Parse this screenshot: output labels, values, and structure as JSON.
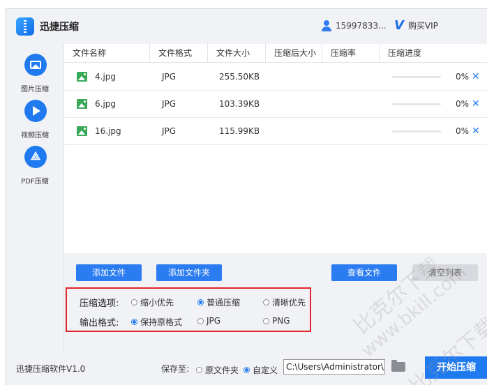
{
  "app": {
    "title": "迅捷压缩"
  },
  "user": {
    "phone": "15997833...",
    "vip_label": "购买VIP"
  },
  "sidebar": {
    "items": [
      {
        "label": "图片压缩"
      },
      {
        "label": "视频压缩"
      },
      {
        "label": "PDF压缩"
      }
    ]
  },
  "table": {
    "headers": [
      "文件名称",
      "文件格式",
      "文件大小",
      "压缩后大小",
      "压缩率",
      "压缩进度"
    ],
    "rows": [
      {
        "name": "4.jpg",
        "format": "JPG",
        "size": "255.50KB",
        "compressed_size": "",
        "ratio": "",
        "progress_pct": "0%",
        "progress_value": 0
      },
      {
        "name": "6.jpg",
        "format": "JPG",
        "size": "103.39KB",
        "compressed_size": "",
        "ratio": "",
        "progress_pct": "0%",
        "progress_value": 0
      },
      {
        "name": "16.jpg",
        "format": "JPG",
        "size": "115.99KB",
        "compressed_size": "",
        "ratio": "",
        "progress_pct": "0%",
        "progress_value": 0
      }
    ]
  },
  "buttons": {
    "add_file": "添加文件",
    "add_folder": "添加文件夹",
    "view_files": "查看文件",
    "clear_list": "清空列表"
  },
  "options": {
    "compress_label": "压缩选项:",
    "compress_choices": [
      "缩小优先",
      "普通压缩",
      "清晰优先"
    ],
    "compress_selected": "普通压缩",
    "format_label": "输出格式:",
    "format_choices": [
      "保持原格式",
      "JPG",
      "PNG"
    ],
    "format_selected": "保持原格式"
  },
  "footer": {
    "version": "迅捷压缩软件V1.0",
    "save_to_label": "保存至:",
    "save_choices": [
      "原文件夹",
      "自定义"
    ],
    "save_selected": "自定义",
    "path_value": "C:\\Users\\Administrator\\De",
    "start_label": "开始压缩"
  },
  "watermarks": [
    "比克尔下载",
    "www.bkill.com",
    "比克尔下载"
  ],
  "colors": {
    "accent": "#1f7af0",
    "highlight_border": "#e0252b"
  }
}
